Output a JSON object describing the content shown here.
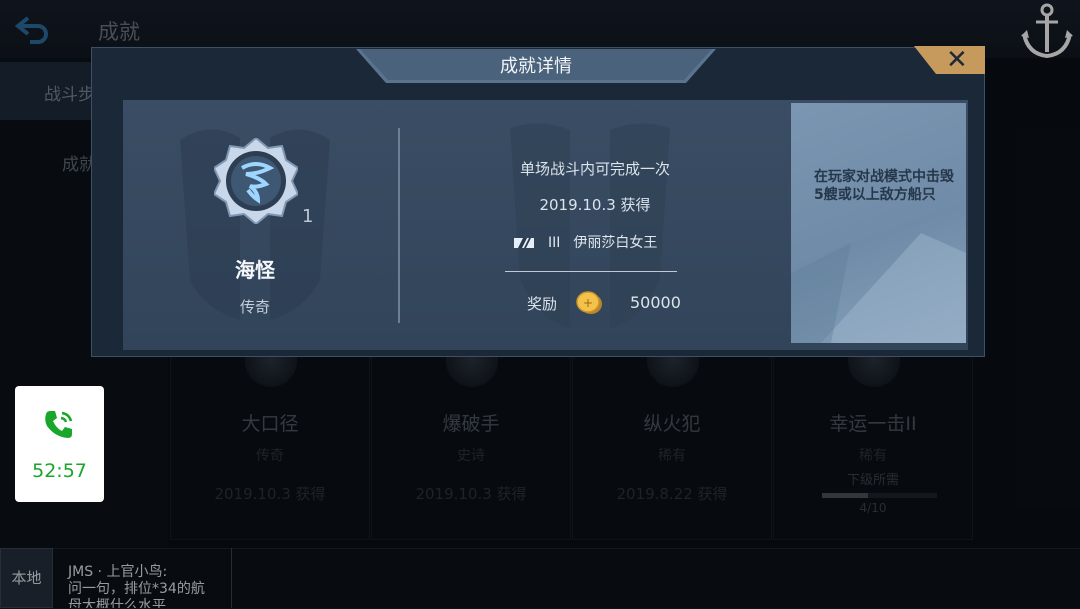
{
  "header": {
    "title": "成就"
  },
  "sidebar": {
    "tabs": [
      {
        "label": "战斗步"
      },
      {
        "label": "成就"
      }
    ]
  },
  "cards": [
    {
      "name": "大口径",
      "rarity": "传奇",
      "date": "2019.10.3 获得"
    },
    {
      "name": "爆破手",
      "rarity": "史诗",
      "date": "2019.10.3 获得"
    },
    {
      "name": "纵火犯",
      "rarity": "稀有",
      "date": "2019.8.22 获得"
    },
    {
      "name": "幸运一击II",
      "rarity": "稀有",
      "sub": "下级所需",
      "progress_text": "4/10",
      "progress": 0.4
    }
  ],
  "call": {
    "timer": "52:57",
    "color": "#1aa52b"
  },
  "chat": {
    "channel": "本地",
    "line1": "JMS · 上官小鸟:",
    "line2": "问一句，排位*34的航",
    "line3": "母大概什么水平"
  },
  "modal": {
    "title": "成就详情",
    "achievement": {
      "name": "海怪",
      "rarity": "传奇",
      "level": "1"
    },
    "condition": "单场战斗内可完成一次",
    "obtained": "2019.10.3 获得",
    "ship": {
      "tier": "III",
      "name": "伊丽莎白女王"
    },
    "reward": {
      "label": "奖励",
      "amount": "50000"
    },
    "description": "在玩家对战模式中击毁5艘或以上敌方船只"
  },
  "icons": [
    "back-arrow-icon",
    "anchor-icon",
    "phone-icon",
    "close-icon",
    "badge-icon",
    "coin-icon",
    "flag-icon"
  ]
}
